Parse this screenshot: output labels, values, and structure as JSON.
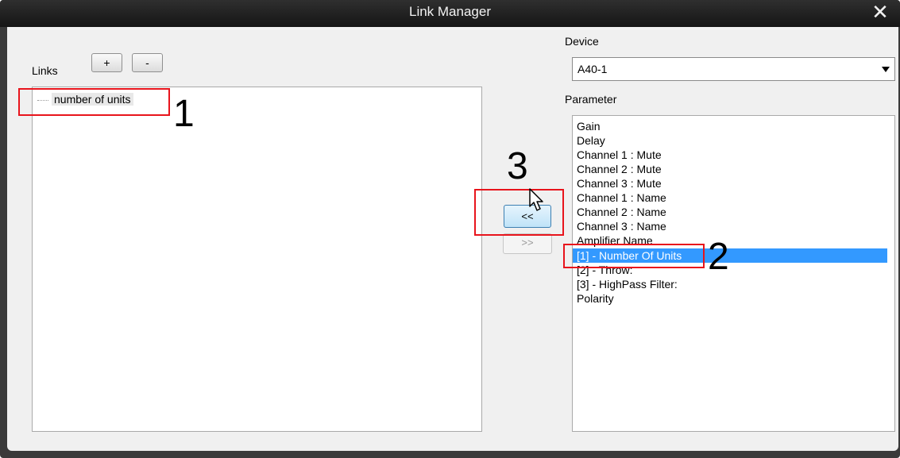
{
  "window": {
    "title": "Link Manager"
  },
  "links": {
    "label": "Links",
    "add_label": "+",
    "remove_label": "-",
    "items": [
      "number of units"
    ]
  },
  "buttons": {
    "link_left": "<<",
    "link_right": ">>"
  },
  "device": {
    "label": "Device",
    "selected": "A40-1"
  },
  "parameter": {
    "label": "Parameter",
    "items": [
      "Gain",
      "Delay",
      "Channel 1 : Mute",
      "Channel 2 : Mute",
      "Channel 3 : Mute",
      "Channel 1 : Name",
      "Channel 2 : Name",
      "Channel 3 : Name",
      "Amplifier Name",
      "[1] - Number Of Units",
      "[2] - Throw:",
      "[3] - HighPass Filter:",
      "Polarity"
    ],
    "selected_index": 9
  },
  "annotations": {
    "one": "1",
    "two": "2",
    "three": "3"
  },
  "colors": {
    "selection": "#3399ff",
    "annotation": "#e8141c"
  }
}
